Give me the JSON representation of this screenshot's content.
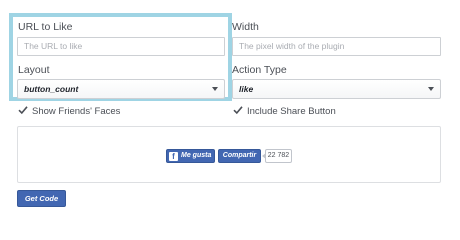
{
  "form": {
    "url": {
      "label": "URL to Like",
      "placeholder": "The URL to like"
    },
    "width": {
      "label": "Width",
      "placeholder": "The pixel width of the plugin"
    },
    "layout": {
      "label": "Layout",
      "selected": "button_count"
    },
    "action_type": {
      "label": "Action Type",
      "selected": "like"
    },
    "show_faces": {
      "label": "Show Friends' Faces",
      "checked": true
    },
    "include_share": {
      "label": "Include Share Button",
      "checked": true
    }
  },
  "preview": {
    "like_label": "Me gusta",
    "share_label": "Compartir",
    "count": "22 782",
    "facebook_icon_glyph": "f"
  },
  "actions": {
    "get_code_label": "Get Code"
  },
  "colors": {
    "facebook_blue": "#4267b2",
    "highlight": "#9fd4e4"
  }
}
